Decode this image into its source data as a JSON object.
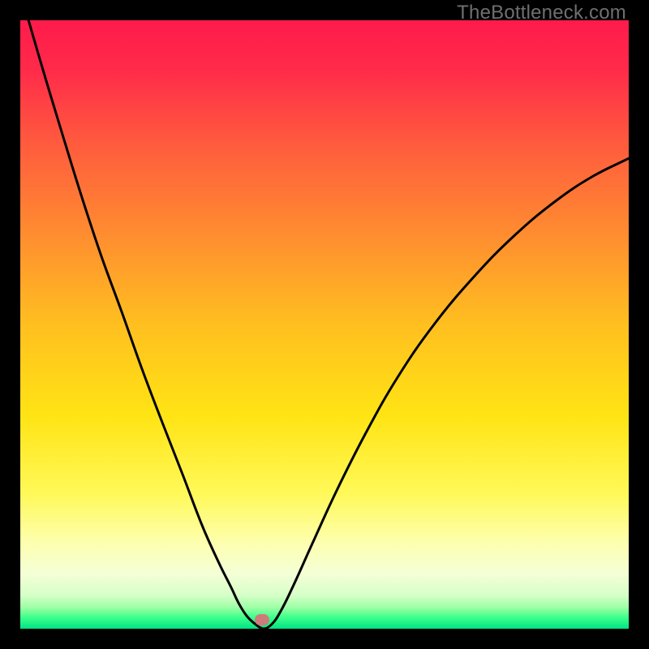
{
  "watermark": "TheBottleneck.com",
  "gradient": {
    "stops": [
      {
        "offset": 0,
        "color": "#ff1b4b"
      },
      {
        "offset": 0.08,
        "color": "#ff2a4a"
      },
      {
        "offset": 0.2,
        "color": "#ff5a3e"
      },
      {
        "offset": 0.35,
        "color": "#ff8c30"
      },
      {
        "offset": 0.5,
        "color": "#ffbf20"
      },
      {
        "offset": 0.65,
        "color": "#ffe414"
      },
      {
        "offset": 0.78,
        "color": "#fff95a"
      },
      {
        "offset": 0.86,
        "color": "#fdffb0"
      },
      {
        "offset": 0.91,
        "color": "#f4ffd6"
      },
      {
        "offset": 0.945,
        "color": "#d6ffc8"
      },
      {
        "offset": 0.965,
        "color": "#9effa6"
      },
      {
        "offset": 0.982,
        "color": "#3bff8a"
      },
      {
        "offset": 1.0,
        "color": "#00e283"
      }
    ]
  },
  "marker": {
    "x_frac": 0.3973,
    "y_frac": 0.9853,
    "color": "#cf7b7b"
  },
  "curve": {
    "stroke": "#000000",
    "width": 3
  },
  "chart_data": {
    "type": "line",
    "title": "",
    "xlabel": "",
    "ylabel": "",
    "xlim": [
      0,
      1
    ],
    "ylim": [
      0,
      1
    ],
    "note": "x and y are fractions of the plot area (0 = left/bottom, 1 = right/top). The curve forms a sharp V-shaped dip reaching ~0 near x≈0.40, with the left branch starting near the top-left and the right branch rising to ~0.77 at the right edge.",
    "series": [
      {
        "name": "bottleneck-curve",
        "x": [
          0.0,
          0.033,
          0.067,
          0.1,
          0.133,
          0.167,
          0.2,
          0.233,
          0.267,
          0.3,
          0.327,
          0.347,
          0.36,
          0.373,
          0.387,
          0.4,
          0.413,
          0.427,
          0.447,
          0.48,
          0.52,
          0.567,
          0.62,
          0.68,
          0.747,
          0.813,
          0.88,
          0.94,
          1.0
        ],
        "y": [
          1.047,
          0.933,
          0.82,
          0.713,
          0.613,
          0.52,
          0.427,
          0.34,
          0.253,
          0.167,
          0.107,
          0.067,
          0.04,
          0.02,
          0.007,
          0.0,
          0.007,
          0.027,
          0.067,
          0.14,
          0.227,
          0.32,
          0.413,
          0.5,
          0.58,
          0.647,
          0.703,
          0.743,
          0.773
        ]
      }
    ],
    "marker_point": {
      "x": 0.3973,
      "y": 0.0147
    }
  }
}
